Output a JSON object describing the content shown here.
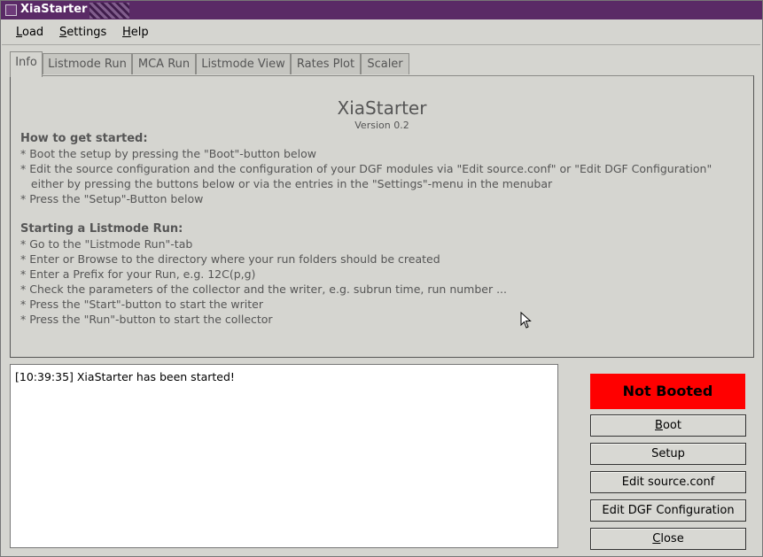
{
  "window": {
    "title": "XiaStarter"
  },
  "menubar": [
    {
      "label": "Load",
      "accel": "L",
      "rest": "oad"
    },
    {
      "label": "Settings",
      "accel": "S",
      "rest": "ettings"
    },
    {
      "label": "Help",
      "accel": "H",
      "rest": "elp"
    }
  ],
  "tabs": [
    "Info",
    "Listmode Run",
    "MCA Run",
    "Listmode View",
    "Rates Plot",
    "Scaler"
  ],
  "active_tab": "Info",
  "info": {
    "title": "XiaStarter",
    "version": "Version 0.2",
    "lines": [
      "How to get started:",
      "* Boot the setup by pressing the \"Boot\"-button below",
      "* Edit the source configuration and the configuration of your DGF modules via \"Edit source.conf\" or \"Edit DGF Configuration\"",
      "   either by pressing the buttons below or via the entries in the \"Settings\"-menu in the menubar",
      "* Press the \"Setup\"-Button below",
      "Starting a Listmode Run:",
      "* Go to the \"Listmode Run\"-tab",
      "* Enter or Browse to the directory where your run folders should be created",
      "* Enter a Prefix for your Run, e.g. 12C(p,g)",
      "* Check the parameters of the collector and the writer, e.g. subrun time, run number ...",
      "* Press the \"Start\"-button to start the writer",
      "* Press the \"Run\"-button to start the collector"
    ]
  },
  "log": {
    "lines": [
      "[10:39:35] XiaStarter has been started!"
    ]
  },
  "status": {
    "label": "Not Booted",
    "color": "#ff0000"
  },
  "buttons": {
    "boot": {
      "accel": "B",
      "rest": "oot"
    },
    "setup": "Setup",
    "edit_source": "Edit source.conf",
    "edit_dgf": "Edit DGF Configuration",
    "close": {
      "accel": "C",
      "rest": "lose"
    }
  }
}
